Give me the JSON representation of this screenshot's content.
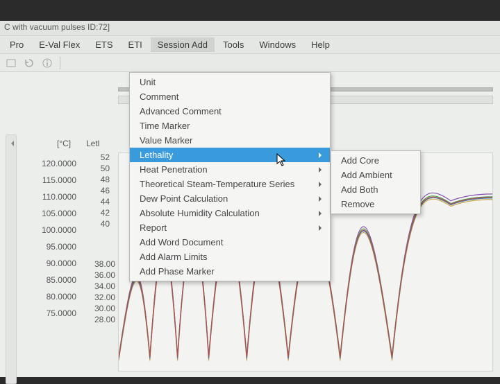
{
  "window": {
    "title": "C with vacuum pulses ID:72]"
  },
  "menubar": {
    "items": [
      "Pro",
      "E-Val Flex",
      "ETS",
      "ETI",
      "Session Add",
      "Tools",
      "Windows",
      "Help"
    ],
    "open_index": 4
  },
  "session_add_menu": {
    "items": [
      {
        "label": "Unit",
        "has_sub": false
      },
      {
        "label": "Comment",
        "has_sub": false
      },
      {
        "label": "Advanced Comment",
        "has_sub": false
      },
      {
        "label": "Time Marker",
        "has_sub": false
      },
      {
        "label": "Value Marker",
        "has_sub": false
      },
      {
        "label": "Lethality",
        "has_sub": true,
        "highlight": true
      },
      {
        "label": "Heat Penetration",
        "has_sub": true
      },
      {
        "label": "Theoretical Steam-Temperature Series",
        "has_sub": true
      },
      {
        "label": "Dew Point Calculation",
        "has_sub": true
      },
      {
        "label": "Absolute Humidity Calculation",
        "has_sub": true
      },
      {
        "label": "Report",
        "has_sub": true
      },
      {
        "label": "Add Word Document",
        "has_sub": false
      },
      {
        "label": "Add Alarm Limits",
        "has_sub": false
      },
      {
        "label": "Add Phase Marker",
        "has_sub": false
      }
    ]
  },
  "lethality_submenu": {
    "items": [
      "Add Core",
      "Add Ambient",
      "Add Both",
      "Remove"
    ]
  },
  "columns": {
    "unit": "[°C]",
    "leti": "Letl"
  },
  "chart_data": {
    "type": "line",
    "ylabel": "",
    "ylim": [
      75,
      120
    ],
    "y_ticks": [
      120.0,
      115.0,
      110.0,
      105.0,
      100.0,
      95.0,
      90.0,
      85.0,
      80.0,
      75.0
    ],
    "secondary_values_upper": [
      52,
      50,
      48,
      46,
      44,
      42,
      40
    ],
    "secondary_values_lower": [
      38.0,
      36.0,
      34.0,
      32.0,
      30.0,
      28.0
    ],
    "note": "Multiple overlapping temperature series with repeated vacuum-pulse dips; exact x-axis not visible."
  }
}
